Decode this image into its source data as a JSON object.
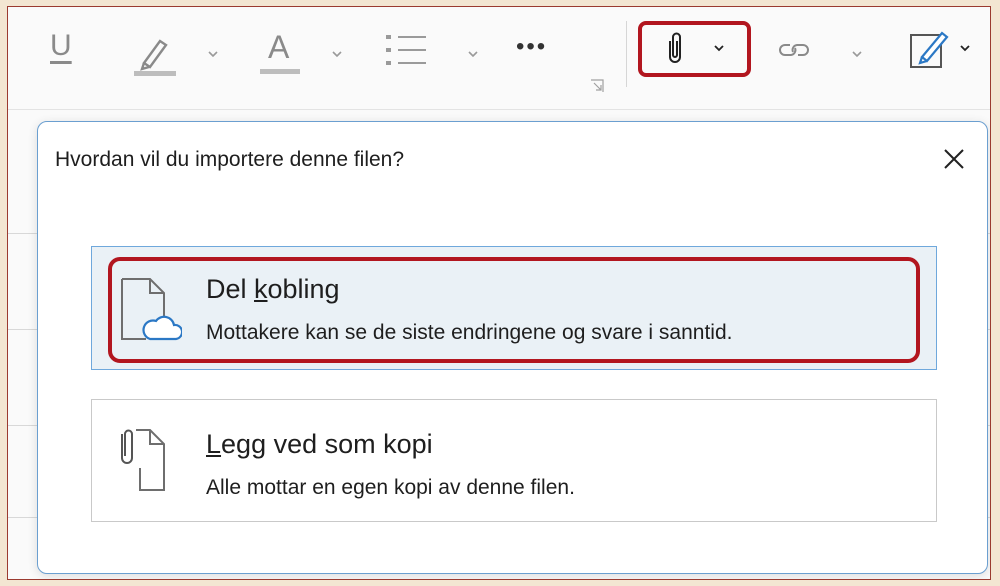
{
  "toolbar": {
    "icons": [
      "underline-icon",
      "highlight-icon",
      "font-color-icon",
      "bullet-list-icon",
      "more-icon",
      "dialog-launcher-icon",
      "attach-file-icon",
      "link-icon",
      "signature-icon"
    ],
    "underline_label": "U",
    "font_color_label": "A",
    "more_label": "•••"
  },
  "dialog": {
    "title": "Hvordan vil du importere denne filen?",
    "close_icon": "close-icon",
    "options": [
      {
        "title_pre": "Del ",
        "title_accel": "k",
        "title_post": "obling",
        "description": "Mottakere kan se de siste endringene og svare i sanntid.",
        "icon": "file-cloud-icon",
        "selected": true
      },
      {
        "title_pre": "",
        "title_accel": "L",
        "title_post": "egg ved som kopi",
        "description": "Alle mottar en egen kopi av denne filen.",
        "icon": "file-attach-icon",
        "selected": false
      }
    ]
  },
  "colors": {
    "highlight_red": "#b2161f",
    "selected_bg": "#eaf1f6",
    "selected_border": "#6fa8dc",
    "icon_gray": "#6e6e6e",
    "accent_blue": "#2b78c5"
  }
}
